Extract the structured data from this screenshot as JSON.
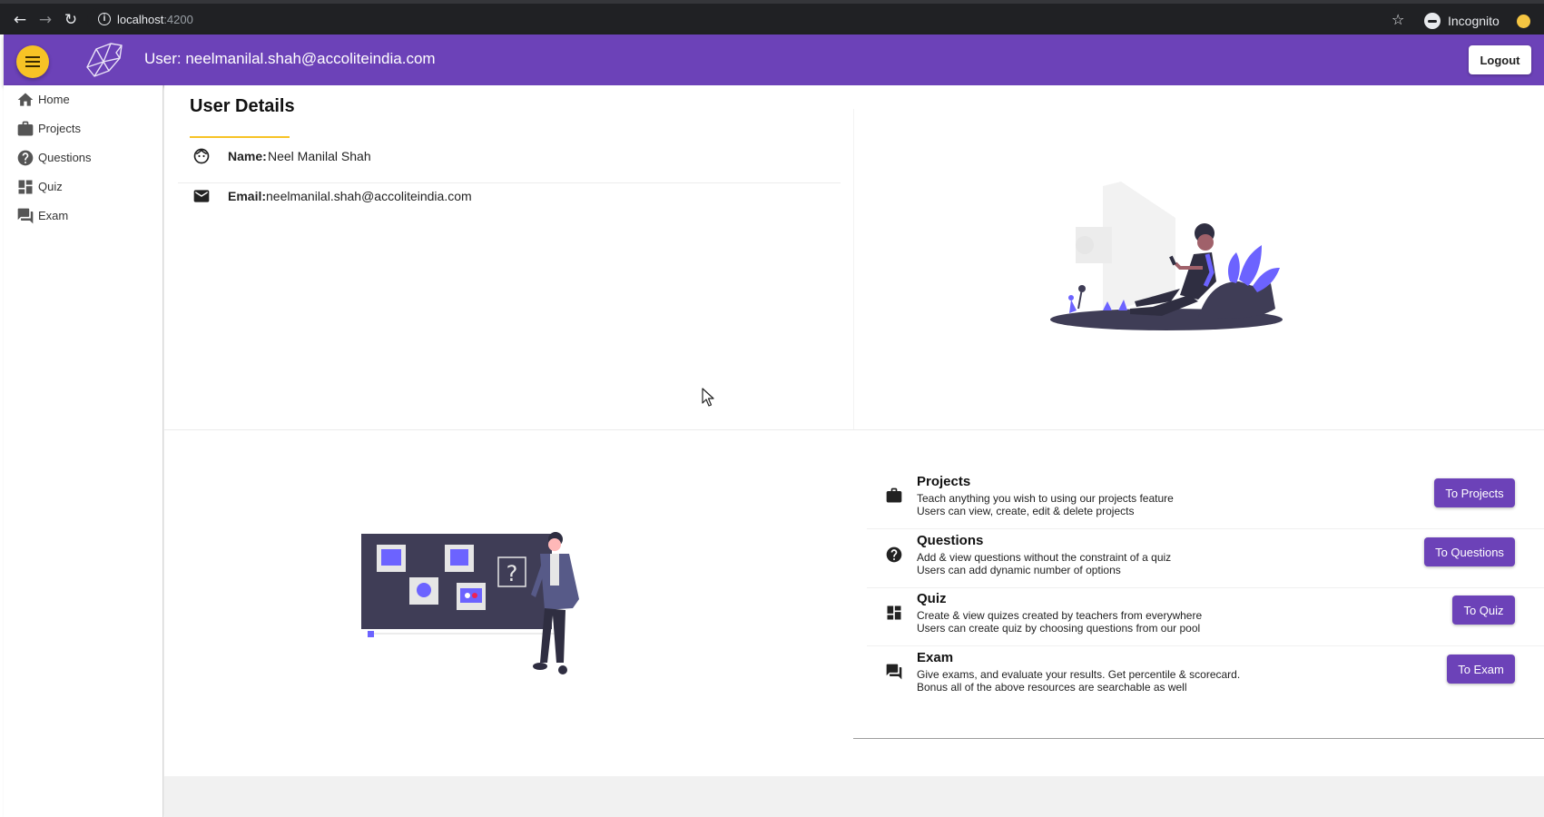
{
  "browser": {
    "url_host": "localhost",
    "url_port": ":4200",
    "profile_label": "Incognito"
  },
  "header": {
    "user_label": "User: neelmanilal.shah@accoliteindia.com",
    "logout_label": "Logout",
    "accent_color": "#6c42b8",
    "menu_button_color": "#f7c325"
  },
  "sidebar": {
    "items": [
      {
        "label": "Home",
        "icon": "home-icon"
      },
      {
        "label": "Projects",
        "icon": "briefcase-icon"
      },
      {
        "label": "Questions",
        "icon": "help-circle-icon"
      },
      {
        "label": "Quiz",
        "icon": "dashboard-icon"
      },
      {
        "label": "Exam",
        "icon": "forum-icon"
      }
    ]
  },
  "user_details": {
    "title": "User Details",
    "name_label": "Name:",
    "name_value": "Neel Manilal Shah",
    "email_label": "Email:",
    "email_value": "neelmanilal.shah@accoliteindia.com"
  },
  "features": [
    {
      "title": "Projects",
      "line1": "Teach anything you wish to using our projects feature",
      "line2": "Users can view, create, edit & delete projects",
      "button": "To Projects",
      "icon": "briefcase-icon"
    },
    {
      "title": "Questions",
      "line1": "Add & view questions without the constraint of a quiz",
      "line2": "Users can add dynamic number of options",
      "button": "To Questions",
      "icon": "help-circle-icon"
    },
    {
      "title": "Quiz",
      "line1": "Create & view quizes created by teachers from everywhere",
      "line2": "Users can create quiz by choosing questions from our pool",
      "button": "To Quiz",
      "icon": "dashboard-icon"
    },
    {
      "title": "Exam",
      "line1": "Give exams, and evaluate your results. Get percentile & scorecard.",
      "line2": "Bonus all of the above resources are searchable as well",
      "button": "To Exam",
      "icon": "forum-icon"
    }
  ]
}
